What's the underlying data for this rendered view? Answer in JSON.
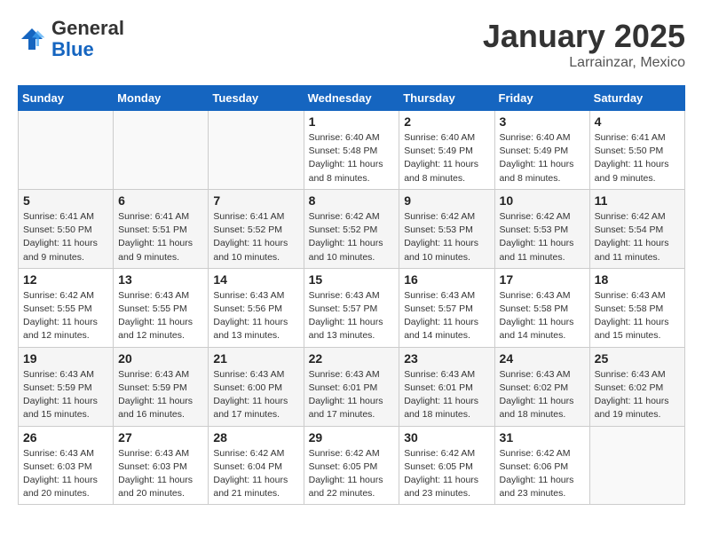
{
  "logo": {
    "text_general": "General",
    "text_blue": "Blue"
  },
  "header": {
    "month_title": "January 2025",
    "subtitle": "Larrainzar, Mexico"
  },
  "days_of_week": [
    "Sunday",
    "Monday",
    "Tuesday",
    "Wednesday",
    "Thursday",
    "Friday",
    "Saturday"
  ],
  "weeks": [
    [
      {
        "day": "",
        "info": ""
      },
      {
        "day": "",
        "info": ""
      },
      {
        "day": "",
        "info": ""
      },
      {
        "day": "1",
        "info": "Sunrise: 6:40 AM\nSunset: 5:48 PM\nDaylight: 11 hours and 8 minutes."
      },
      {
        "day": "2",
        "info": "Sunrise: 6:40 AM\nSunset: 5:49 PM\nDaylight: 11 hours and 8 minutes."
      },
      {
        "day": "3",
        "info": "Sunrise: 6:40 AM\nSunset: 5:49 PM\nDaylight: 11 hours and 8 minutes."
      },
      {
        "day": "4",
        "info": "Sunrise: 6:41 AM\nSunset: 5:50 PM\nDaylight: 11 hours and 9 minutes."
      }
    ],
    [
      {
        "day": "5",
        "info": "Sunrise: 6:41 AM\nSunset: 5:50 PM\nDaylight: 11 hours and 9 minutes."
      },
      {
        "day": "6",
        "info": "Sunrise: 6:41 AM\nSunset: 5:51 PM\nDaylight: 11 hours and 9 minutes."
      },
      {
        "day": "7",
        "info": "Sunrise: 6:41 AM\nSunset: 5:52 PM\nDaylight: 11 hours and 10 minutes."
      },
      {
        "day": "8",
        "info": "Sunrise: 6:42 AM\nSunset: 5:52 PM\nDaylight: 11 hours and 10 minutes."
      },
      {
        "day": "9",
        "info": "Sunrise: 6:42 AM\nSunset: 5:53 PM\nDaylight: 11 hours and 10 minutes."
      },
      {
        "day": "10",
        "info": "Sunrise: 6:42 AM\nSunset: 5:53 PM\nDaylight: 11 hours and 11 minutes."
      },
      {
        "day": "11",
        "info": "Sunrise: 6:42 AM\nSunset: 5:54 PM\nDaylight: 11 hours and 11 minutes."
      }
    ],
    [
      {
        "day": "12",
        "info": "Sunrise: 6:42 AM\nSunset: 5:55 PM\nDaylight: 11 hours and 12 minutes."
      },
      {
        "day": "13",
        "info": "Sunrise: 6:43 AM\nSunset: 5:55 PM\nDaylight: 11 hours and 12 minutes."
      },
      {
        "day": "14",
        "info": "Sunrise: 6:43 AM\nSunset: 5:56 PM\nDaylight: 11 hours and 13 minutes."
      },
      {
        "day": "15",
        "info": "Sunrise: 6:43 AM\nSunset: 5:57 PM\nDaylight: 11 hours and 13 minutes."
      },
      {
        "day": "16",
        "info": "Sunrise: 6:43 AM\nSunset: 5:57 PM\nDaylight: 11 hours and 14 minutes."
      },
      {
        "day": "17",
        "info": "Sunrise: 6:43 AM\nSunset: 5:58 PM\nDaylight: 11 hours and 14 minutes."
      },
      {
        "day": "18",
        "info": "Sunrise: 6:43 AM\nSunset: 5:58 PM\nDaylight: 11 hours and 15 minutes."
      }
    ],
    [
      {
        "day": "19",
        "info": "Sunrise: 6:43 AM\nSunset: 5:59 PM\nDaylight: 11 hours and 15 minutes."
      },
      {
        "day": "20",
        "info": "Sunrise: 6:43 AM\nSunset: 5:59 PM\nDaylight: 11 hours and 16 minutes."
      },
      {
        "day": "21",
        "info": "Sunrise: 6:43 AM\nSunset: 6:00 PM\nDaylight: 11 hours and 17 minutes."
      },
      {
        "day": "22",
        "info": "Sunrise: 6:43 AM\nSunset: 6:01 PM\nDaylight: 11 hours and 17 minutes."
      },
      {
        "day": "23",
        "info": "Sunrise: 6:43 AM\nSunset: 6:01 PM\nDaylight: 11 hours and 18 minutes."
      },
      {
        "day": "24",
        "info": "Sunrise: 6:43 AM\nSunset: 6:02 PM\nDaylight: 11 hours and 18 minutes."
      },
      {
        "day": "25",
        "info": "Sunrise: 6:43 AM\nSunset: 6:02 PM\nDaylight: 11 hours and 19 minutes."
      }
    ],
    [
      {
        "day": "26",
        "info": "Sunrise: 6:43 AM\nSunset: 6:03 PM\nDaylight: 11 hours and 20 minutes."
      },
      {
        "day": "27",
        "info": "Sunrise: 6:43 AM\nSunset: 6:03 PM\nDaylight: 11 hours and 20 minutes."
      },
      {
        "day": "28",
        "info": "Sunrise: 6:42 AM\nSunset: 6:04 PM\nDaylight: 11 hours and 21 minutes."
      },
      {
        "day": "29",
        "info": "Sunrise: 6:42 AM\nSunset: 6:05 PM\nDaylight: 11 hours and 22 minutes."
      },
      {
        "day": "30",
        "info": "Sunrise: 6:42 AM\nSunset: 6:05 PM\nDaylight: 11 hours and 23 minutes."
      },
      {
        "day": "31",
        "info": "Sunrise: 6:42 AM\nSunset: 6:06 PM\nDaylight: 11 hours and 23 minutes."
      },
      {
        "day": "",
        "info": ""
      }
    ]
  ]
}
